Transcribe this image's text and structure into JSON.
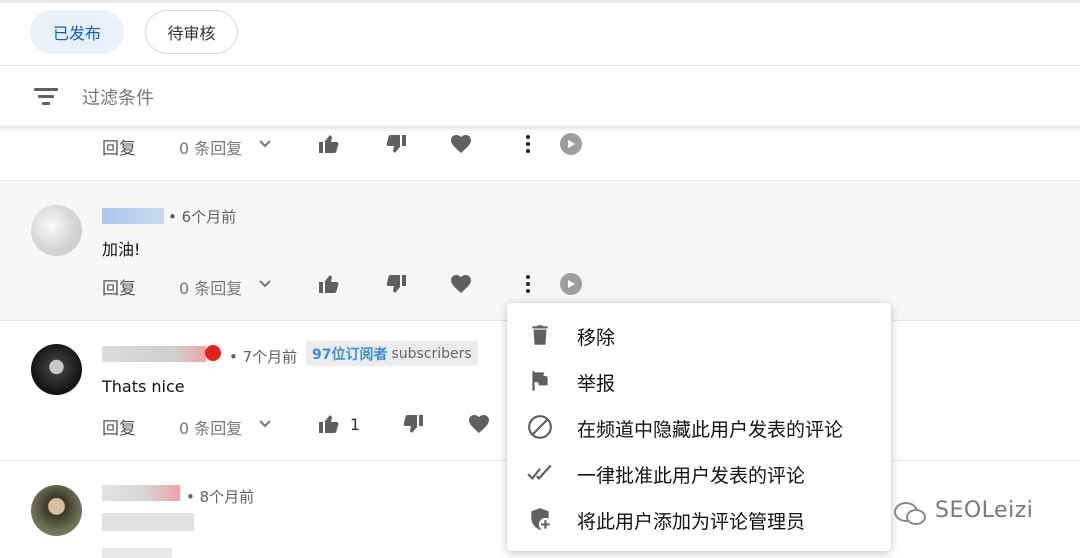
{
  "tabs": {
    "published": "已发布",
    "pending": "待审核"
  },
  "filter": {
    "label": "过滤条件"
  },
  "actions": {
    "reply": "回复",
    "reply_count": "0 条回复"
  },
  "comments": [
    {
      "time": "6个月前",
      "text": "加油!"
    },
    {
      "time": "7个月前",
      "text": "Thats nice",
      "likes": "1",
      "badge": {
        "subscribers_cn": "97位订阅者",
        "subscribers_en": "subscribers"
      }
    },
    {
      "time": "8个月前"
    }
  ],
  "context_menu": {
    "items": [
      {
        "label": "移除",
        "icon": "trash-icon"
      },
      {
        "label": "举报",
        "icon": "flag-icon"
      },
      {
        "label": "在频道中隐藏此用户发表的评论",
        "icon": "block-icon"
      },
      {
        "label": "一律批准此用户发表的评论",
        "icon": "double-check-icon"
      },
      {
        "label": "将此用户添加为评论管理员",
        "icon": "shield-add-icon"
      }
    ]
  },
  "watermark": "SEOLeizi",
  "colors": {
    "accent": "#065fd4",
    "chip_bg": "#e9f1fb",
    "badge_text": "#3a8fd8",
    "hover_row": "#f7f7f7"
  }
}
